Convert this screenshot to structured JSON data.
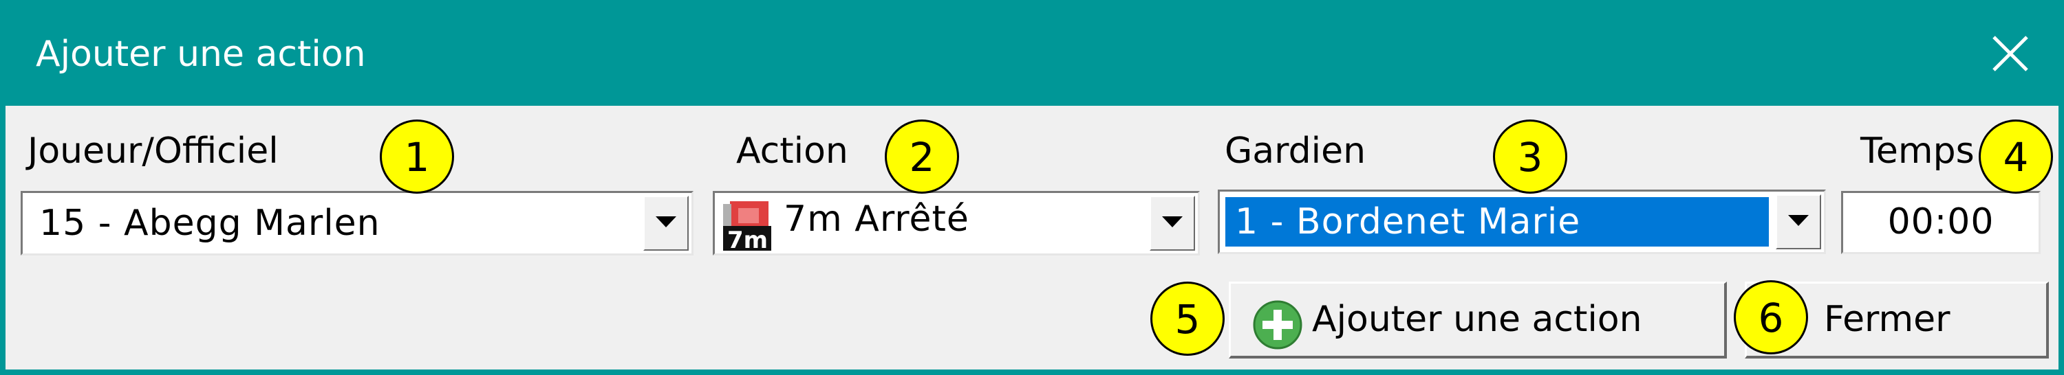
{
  "window": {
    "title": "Ajouter une action"
  },
  "fields": {
    "player": {
      "label": "Joueur/Officiel",
      "value": "15 - Abegg Marlen"
    },
    "action": {
      "label": "Action",
      "value": "7m Arrêté",
      "icon": "7m-penalty-icon"
    },
    "goalkeeper": {
      "label": "Gardien",
      "value": "1 - Bordenet Marie"
    },
    "time": {
      "label": "Temps",
      "value": "00:00"
    }
  },
  "buttons": {
    "add": "Ajouter une action",
    "close": "Fermer"
  },
  "callouts": [
    "1",
    "2",
    "3",
    "4",
    "5",
    "6"
  ],
  "colors": {
    "titlebar": "#009797",
    "selection": "#0078d7",
    "callout": "#ffff00"
  }
}
